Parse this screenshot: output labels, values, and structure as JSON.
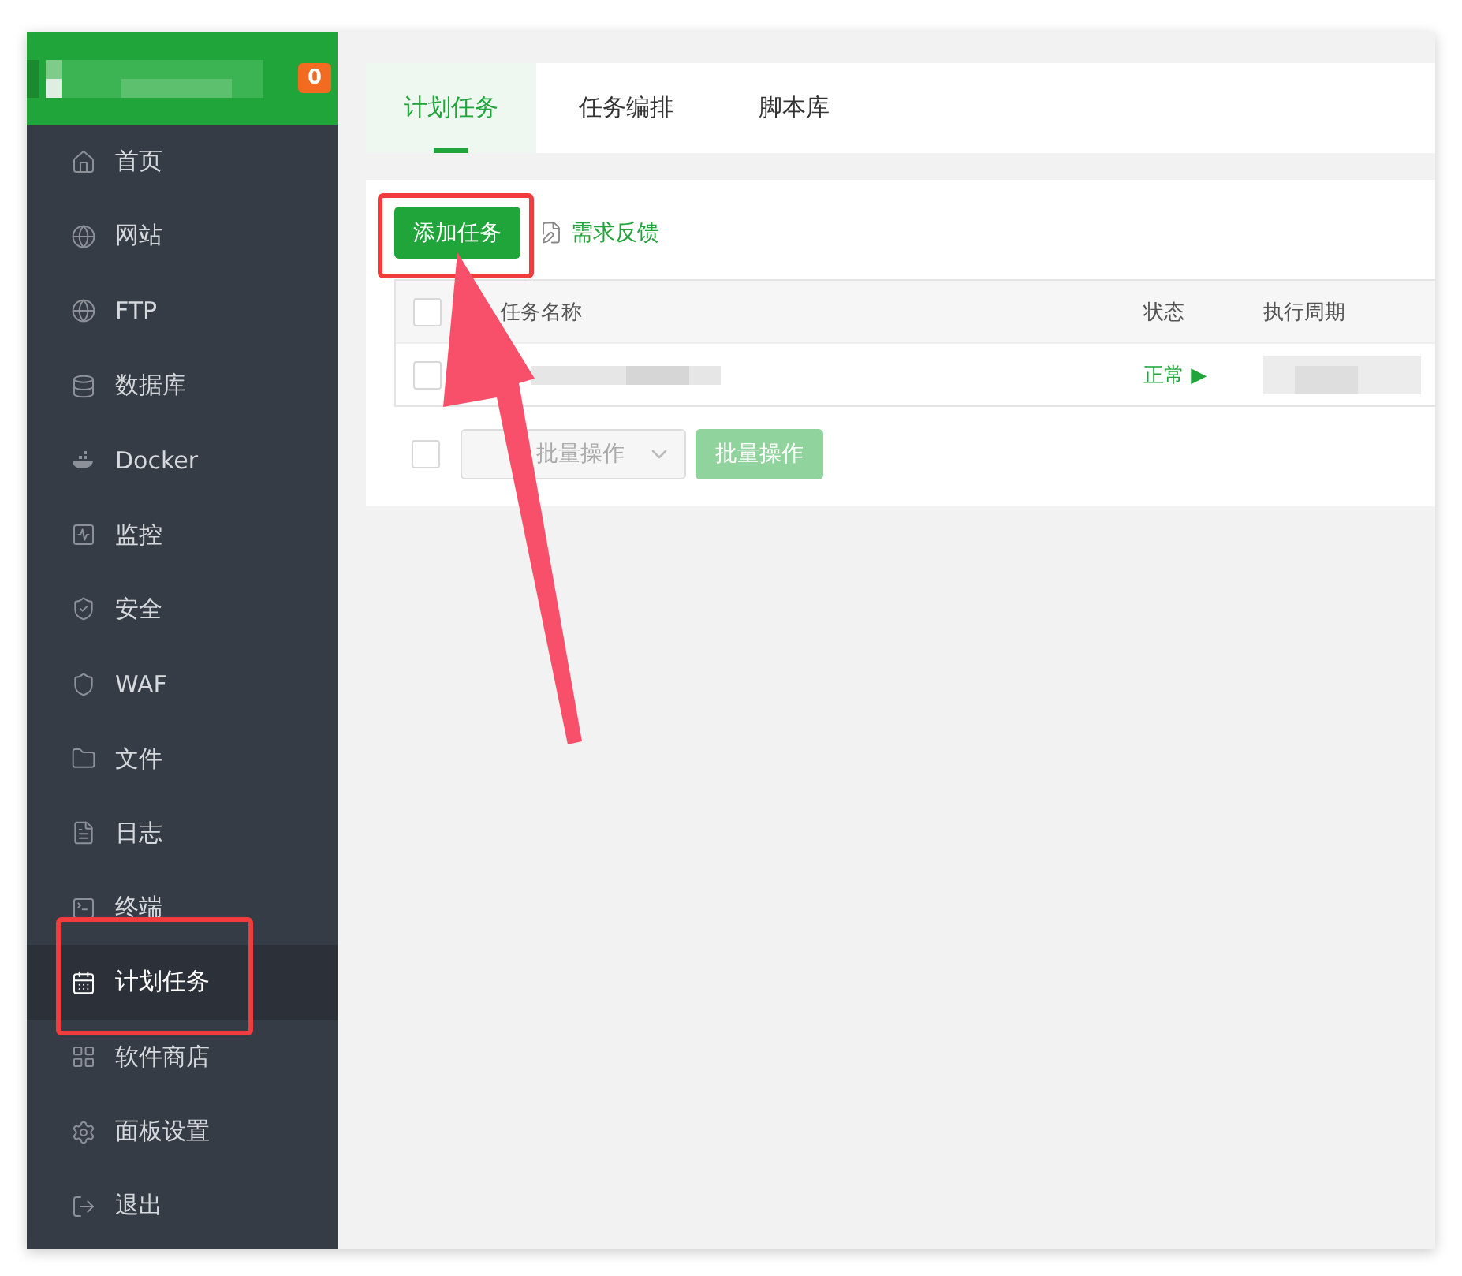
{
  "header": {
    "badge": "0"
  },
  "sidebar": {
    "items": [
      {
        "label": "首页",
        "selected": false
      },
      {
        "label": "网站",
        "selected": false
      },
      {
        "label": "FTP",
        "selected": false
      },
      {
        "label": "数据库",
        "selected": false
      },
      {
        "label": "Docker",
        "selected": false
      },
      {
        "label": "监控",
        "selected": false
      },
      {
        "label": "安全",
        "selected": false
      },
      {
        "label": "WAF",
        "selected": false
      },
      {
        "label": "文件",
        "selected": false
      },
      {
        "label": "日志",
        "selected": false
      },
      {
        "label": "终端",
        "selected": false
      },
      {
        "label": "计划任务",
        "selected": true
      },
      {
        "label": "软件商店",
        "selected": false
      },
      {
        "label": "面板设置",
        "selected": false
      },
      {
        "label": "退出",
        "selected": false
      }
    ]
  },
  "tabs": [
    {
      "label": "计划任务",
      "selected": true
    },
    {
      "label": "任务编排",
      "selected": false
    },
    {
      "label": "脚本库",
      "selected": false
    }
  ],
  "toolbar": {
    "add_button": "添加任务",
    "feedback_link": "需求反馈"
  },
  "table": {
    "header_checked": false,
    "footer_checked": false,
    "columns": [
      "任务名称",
      "状态",
      "执行周期"
    ],
    "rows": [
      {
        "checked": false,
        "status": "正常",
        "status_symbol": "▶"
      }
    ],
    "batch_select": "批量操作",
    "batch_button": "批量操作"
  }
}
